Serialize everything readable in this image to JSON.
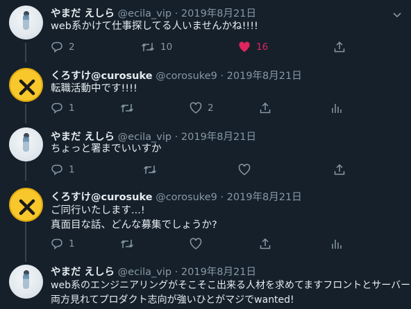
{
  "tweets": [
    {
      "name": "やまだ えしら",
      "handle": "@ecila_vip",
      "date": "2019年8月21日",
      "lines": [
        "web系かけて仕事探してる人いませんかね!!!!"
      ],
      "reply_count": "2",
      "retweet_count": "10",
      "like_count": "16",
      "liked": true,
      "avatar_icon": "profile-photo",
      "show_analytics": false
    },
    {
      "name": "くろすけ@curosuke",
      "handle": "@corosuke9",
      "date": "2019年8月21日",
      "lines": [
        "転職活動中です!!!!"
      ],
      "reply_count": "1",
      "retweet_count": "",
      "like_count": "2",
      "liked": false,
      "avatar_icon": "x-eyes-emoji",
      "show_analytics": true
    },
    {
      "name": "やまだ えしら",
      "handle": "@ecila_vip",
      "date": "2019年8月21日",
      "lines": [
        "ちょっと署までいいすか"
      ],
      "reply_count": "1",
      "retweet_count": "",
      "like_count": "",
      "liked": false,
      "avatar_icon": "profile-photo",
      "show_analytics": false
    },
    {
      "name": "くろすけ@curosuke",
      "handle": "@corosuke9",
      "date": "2019年8月21日",
      "lines": [
        "ご同行いたします...!",
        "真面目な話、どんな募集でしょうか?"
      ],
      "reply_count": "1",
      "retweet_count": "",
      "like_count": "",
      "liked": false,
      "avatar_icon": "x-eyes-emoji",
      "show_analytics": true
    },
    {
      "name": "やまだ えしら",
      "handle": "@ecila_vip",
      "date": "2019年8月21日",
      "lines": [
        "web系のエンジニアリングがそこそこ出来る人材を求めてますフロントとサーバー",
        "両方見れてプロダクト志向が強いひとがマジでwanted!"
      ],
      "reply_count": "",
      "retweet_count": "",
      "like_count": "",
      "liked": false,
      "avatar_icon": "profile-photo",
      "show_analytics": false
    }
  ],
  "colors": {
    "background": "#15202b",
    "secondary_text": "#8899a6",
    "like_active": "#e0245e",
    "thread_line": "#38444d"
  }
}
